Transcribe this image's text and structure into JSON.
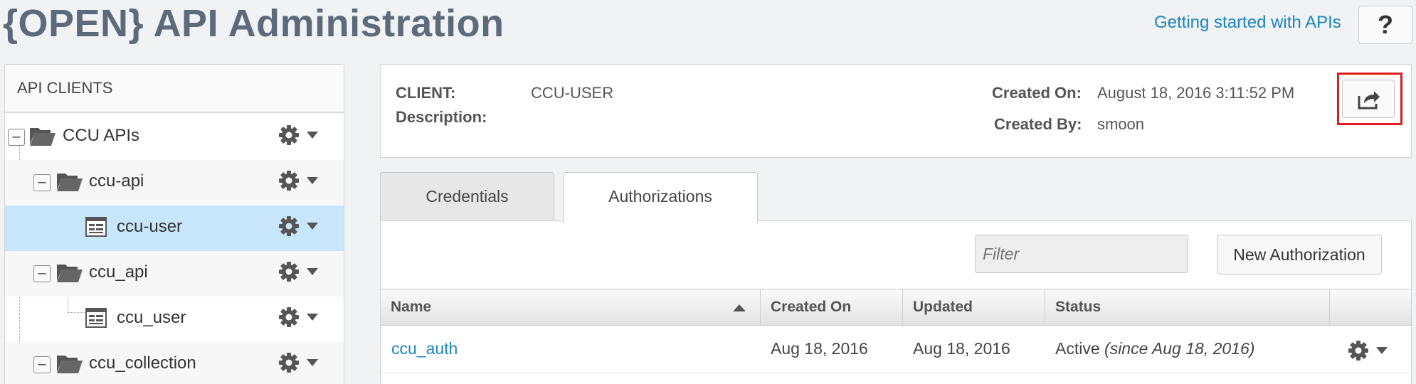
{
  "header": {
    "title": "{OPEN} API Administration",
    "getting_started": "Getting started with APIs",
    "help_label": "?"
  },
  "sidebar": {
    "title": "API CLIENTS",
    "items": [
      {
        "label": "CCU APIs",
        "type": "folder",
        "level": 0
      },
      {
        "label": "ccu-api",
        "type": "folder",
        "level": 1
      },
      {
        "label": "ccu-user",
        "type": "client",
        "level": 2,
        "selected": true
      },
      {
        "label": "ccu_api",
        "type": "folder",
        "level": 1
      },
      {
        "label": "ccu_user",
        "type": "client",
        "level": 2
      },
      {
        "label": "ccu_collection",
        "type": "folder",
        "level": 1
      }
    ]
  },
  "client": {
    "client_label": "CLIENT:",
    "client_value": "CCU-USER",
    "description_label": "Description:",
    "description_value": "",
    "created_on_label": "Created On:",
    "created_on_value": "August 18, 2016 3:11:52 PM",
    "created_by_label": "Created By:",
    "created_by_value": "smoon"
  },
  "tabs": [
    {
      "label": "Credentials",
      "active": false
    },
    {
      "label": "Authorizations",
      "active": true
    }
  ],
  "toolbar": {
    "filter_placeholder": "Filter",
    "new_authorization_label": "New Authorization"
  },
  "table": {
    "columns": [
      "Name",
      "Created On",
      "Updated",
      "Status"
    ],
    "rows": [
      {
        "name": "ccu_auth",
        "created_on": "Aug 18, 2016",
        "updated": "Aug 18, 2016",
        "status": "Active",
        "status_since": "(since Aug 18, 2016)"
      }
    ]
  },
  "colors": {
    "accent": "#1a84c0",
    "selected_row": "#c7e6fb",
    "title": "#5b6b7c",
    "highlight": "#e01b1b"
  }
}
